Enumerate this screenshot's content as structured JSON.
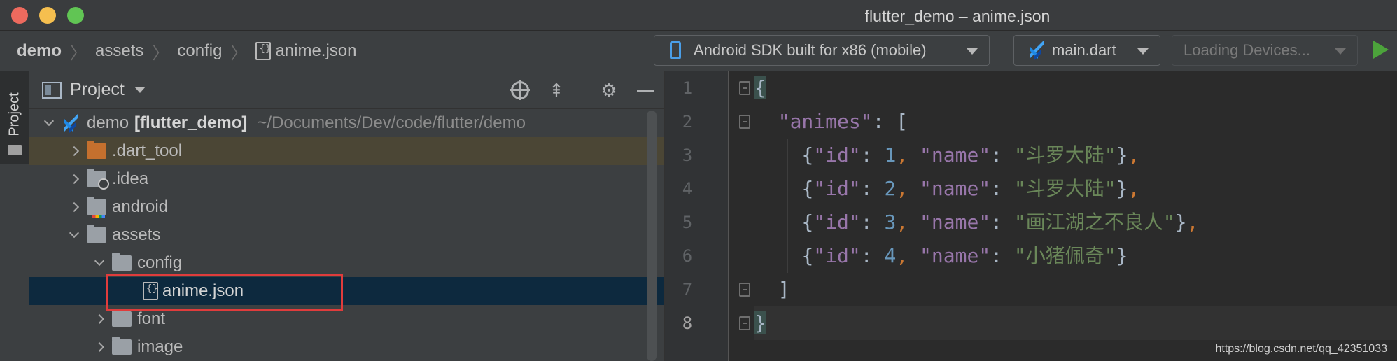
{
  "window": {
    "title": "flutter_demo – anime.json"
  },
  "breadcrumb": {
    "items": [
      "demo",
      "assets",
      "config",
      "anime.json"
    ]
  },
  "toolbar": {
    "device": "Android SDK built for x86 (mobile)",
    "run_config": "main.dart",
    "devices_placeholder": "Loading Devices..."
  },
  "toolstrip": {
    "project_tab": "Project"
  },
  "project_panel": {
    "title": "Project",
    "root": {
      "name": "demo",
      "module": "[flutter_demo]",
      "path": "~/Documents/Dev/code/flutter/demo"
    },
    "items": [
      {
        "name": ".dart_tool",
        "depth": 1,
        "expanded": false
      },
      {
        "name": ".idea",
        "depth": 1,
        "expanded": false
      },
      {
        "name": "android",
        "depth": 1,
        "expanded": false
      },
      {
        "name": "assets",
        "depth": 1,
        "expanded": true
      },
      {
        "name": "config",
        "depth": 2,
        "expanded": true
      },
      {
        "name": "anime.json",
        "depth": 3,
        "selected": true
      },
      {
        "name": "font",
        "depth": 2,
        "expanded": false
      },
      {
        "name": "image",
        "depth": 2,
        "expanded": false
      }
    ]
  },
  "editor": {
    "line_numbers": [
      "1",
      "2",
      "3",
      "4",
      "5",
      "6",
      "7",
      "8"
    ],
    "current_line": "8",
    "code": {
      "key_animes": "\"animes\"",
      "key_id": "\"id\"",
      "key_name": "\"name\"",
      "ids": [
        "1",
        "2",
        "3",
        "4"
      ],
      "names": [
        "\"斗罗大陆\"",
        "\"斗罗大陆\"",
        "\"画江湖之不良人\"",
        "\"小猪佩奇\""
      ]
    }
  },
  "watermark": "https://blog.csdn.net/qq_42351033",
  "colors": {
    "accent_blue": "#4a9ee8",
    "selection": "#0d293e",
    "excluded_folder": "#c4702e",
    "highlight_box": "#e03c3c",
    "json_key": "#9876aa",
    "json_string": "#6a8759",
    "json_number": "#6897bb"
  }
}
